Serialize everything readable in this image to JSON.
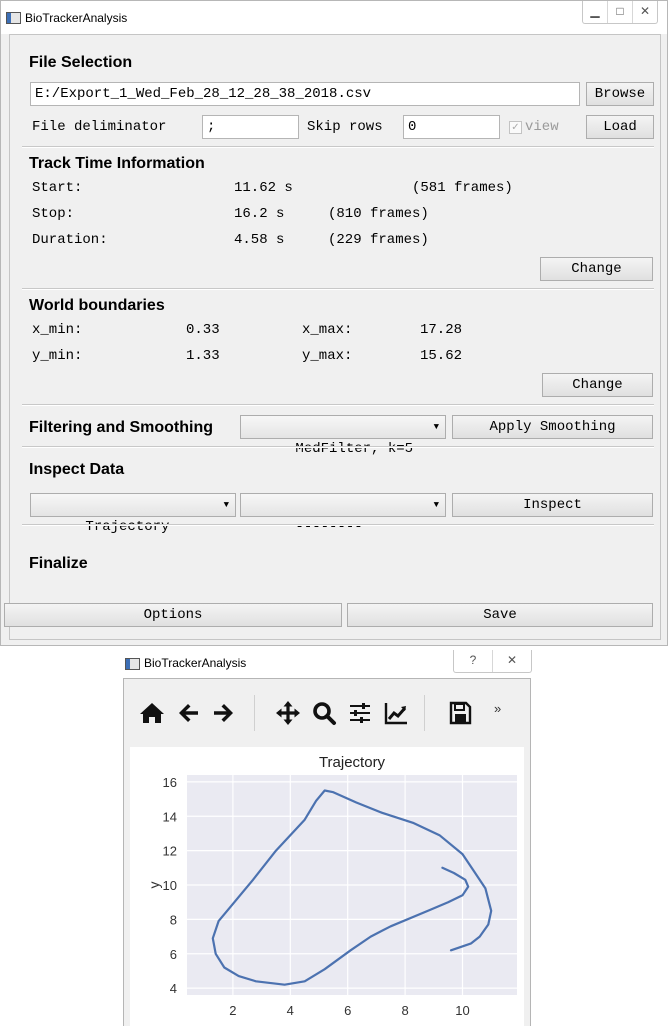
{
  "main_window": {
    "title": "BioTrackerAnalysis",
    "file_selection": {
      "heading": "File Selection",
      "path": "E:/Export_1_Wed_Feb_28_12_28_38_2018.csv",
      "browse": "Browse",
      "delimiter_label": "File deliminator",
      "delimiter_value": ";",
      "skip_rows_label": "Skip rows",
      "skip_rows_value": "0",
      "view_label": "view",
      "view_checked": true,
      "load": "Load"
    },
    "track_time": {
      "heading": "Track Time Information",
      "start_label": "Start:",
      "start_value": "11.62 s",
      "start_frames": "(581 frames)",
      "stop_label": "Stop:",
      "stop_value": "16.2 s",
      "stop_frames": "(810 frames)",
      "duration_label": "Duration:",
      "duration_value": "4.58 s",
      "duration_frames": "(229 frames)",
      "change": "Change"
    },
    "world_boundaries": {
      "heading": "World boundaries",
      "x_min_label": "x_min:",
      "x_min_value": "0.33",
      "x_max_label": "x_max:",
      "x_max_value": "17.28",
      "y_min_label": "y_min:",
      "y_min_value": "1.33",
      "y_max_label": "y_max:",
      "y_max_value": "15.62",
      "change": "Change"
    },
    "filtering": {
      "heading": "Filtering and Smoothing",
      "filter_selected": "MedFilter, k=5",
      "apply": "Apply Smoothing"
    },
    "inspect": {
      "heading": "Inspect Data",
      "data_selected": "Trajectory",
      "second_selected": "--------",
      "inspect": "Inspect"
    },
    "finalize": {
      "heading": "Finalize",
      "options": "Options",
      "save": "Save"
    }
  },
  "plot_window": {
    "title": "BioTrackerAnalysis",
    "help_glyph": "?",
    "close_glyph": "✕",
    "overflow_glyph": "»",
    "toolbar": [
      "home-icon",
      "back-icon",
      "forward-icon",
      "pan-icon",
      "zoom-icon",
      "subplots-icon",
      "edit-curves-icon",
      "save-icon"
    ]
  },
  "chart_data": {
    "type": "line",
    "title": "Trajectory",
    "xlabel": "",
    "ylabel": "y",
    "xlim": [
      0.4,
      11.9
    ],
    "ylim": [
      3.6,
      16.4
    ],
    "xticks": [
      2,
      4,
      6,
      8,
      10
    ],
    "yticks": [
      4,
      6,
      8,
      10,
      12,
      14,
      16
    ],
    "grid": true,
    "series": [
      {
        "color": "#4c72b0",
        "x": [
          9.3,
          9.7,
          10.1,
          10.2,
          10.0,
          9.5,
          8.8,
          7.5,
          6.8,
          6.1,
          5.2,
          4.5,
          3.8,
          2.8,
          2.2,
          1.7,
          1.4,
          1.3,
          1.5,
          2.0,
          2.7,
          3.5,
          4.5,
          4.9,
          5.2,
          5.5,
          6.3,
          7.2,
          8.3,
          9.2,
          10.0,
          10.4,
          10.8,
          11.0,
          10.9,
          10.6,
          10.3,
          9.6
        ],
        "y": [
          11.0,
          10.7,
          10.3,
          9.9,
          9.4,
          9.0,
          8.5,
          7.6,
          7.0,
          6.2,
          5.1,
          4.4,
          4.2,
          4.4,
          4.7,
          5.2,
          6.0,
          6.9,
          7.9,
          8.9,
          10.3,
          12.0,
          13.8,
          14.9,
          15.5,
          15.4,
          14.8,
          14.2,
          13.6,
          12.9,
          11.8,
          10.8,
          9.8,
          8.5,
          7.7,
          7.0,
          6.6,
          6.2
        ]
      }
    ]
  }
}
